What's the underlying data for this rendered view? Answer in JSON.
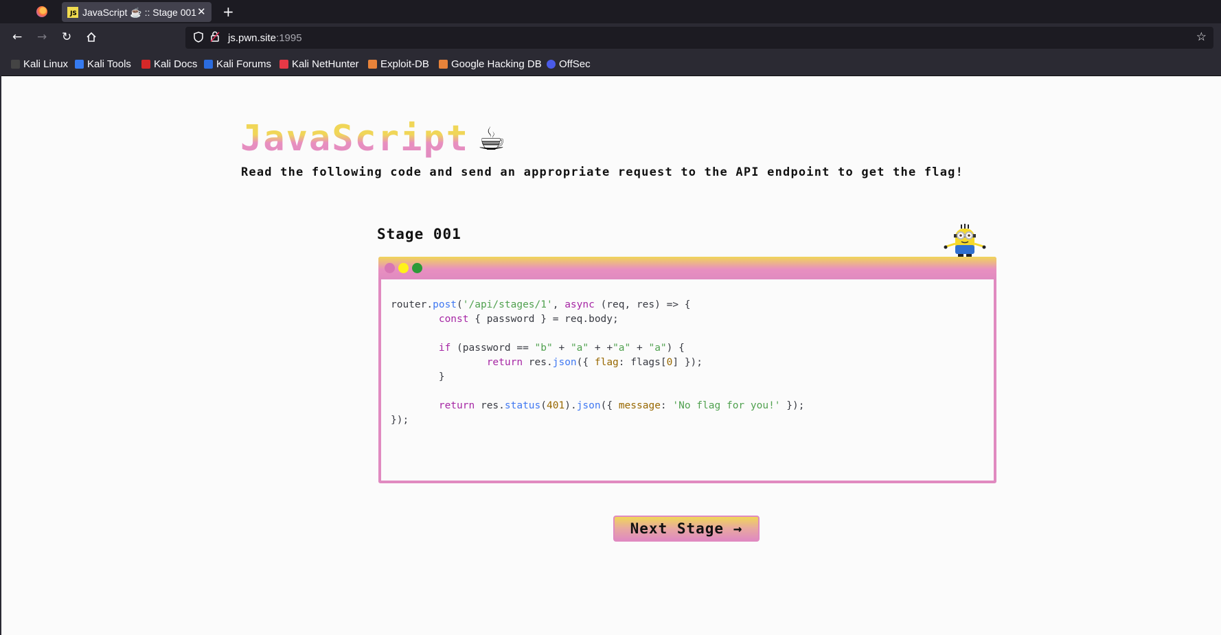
{
  "browser": {
    "tab": {
      "favicon_text": "JS",
      "title": "JavaScript ☕ :: Stage 001",
      "close_icon": "close-icon"
    },
    "url": {
      "host": "js.pwn.site",
      "port": ":1995"
    },
    "bookmarks": [
      {
        "label": "Kali Linux",
        "color": "#1c1b22"
      },
      {
        "label": "Kali Tools",
        "color": "#367bf0"
      },
      {
        "label": "Kali Docs",
        "color": "#d62828"
      },
      {
        "label": "Kali Forums",
        "color": "#2b6cde"
      },
      {
        "label": "Kali NetHunter",
        "color": "#e63946"
      },
      {
        "label": "Exploit-DB",
        "color": "#e8833a"
      },
      {
        "label": "Google Hacking DB",
        "color": "#e8833a"
      },
      {
        "label": "OffSec",
        "color": "#4a5be8"
      }
    ]
  },
  "page": {
    "title": "JavaScript",
    "title_emoji": "☕",
    "subtitle": "Read the following code and send an appropriate request to the API endpoint to get the flag!",
    "stage_title": "Stage 001",
    "next_button": "Next Stage →"
  },
  "colors": {
    "accent_yellow": "#f0d658",
    "accent_pink": "#e08ac0"
  }
}
